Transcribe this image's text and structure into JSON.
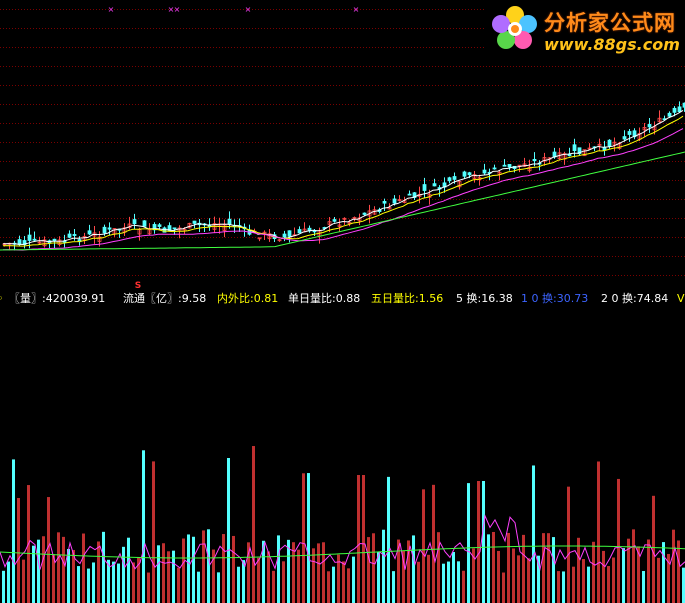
{
  "logo": {
    "name": "分析家公式网",
    "url": "www.88gs.com",
    "colors": {
      "name": "#ff8a1a",
      "url": "#ffc21a"
    }
  },
  "signal_label": "S",
  "info_bar": [
    {
      "key": "volume",
      "label": "〖量〗:",
      "value": "420039.91",
      "label_color": "#ffffff",
      "value_color": "#ffffff"
    },
    {
      "key": "float",
      "label": "流通〖亿〗:",
      "value": "9.58",
      "label_color": "#ffffff",
      "value_color": "#ffffff"
    },
    {
      "key": "inout_ratio",
      "label": "内外比:",
      "value": "0.81",
      "label_color": "#ffff00",
      "value_color": "#ffff00"
    },
    {
      "key": "day_vol_ratio",
      "label": "单日量比:",
      "value": "0.88",
      "label_color": "#ffffff",
      "value_color": "#ffffff"
    },
    {
      "key": "5day_vol_ratio",
      "label": "五日量比:",
      "value": "1.56",
      "label_color": "#ffff00",
      "value_color": "#ffff00"
    },
    {
      "key": "turn5",
      "label": "5 换:",
      "value": "16.38",
      "label_color": "#ffffff",
      "value_color": "#ffffff"
    },
    {
      "key": "turn10",
      "label": "1 0 换:",
      "value": "30.73",
      "label_color": "#3c64ff",
      "value_color": "#3c64ff"
    },
    {
      "key": "turn20",
      "label": "2 0 换:",
      "value": "74.84",
      "label_color": "#ffffff",
      "value_color": "#ffffff"
    },
    {
      "key": "more",
      "label": "V",
      "value": "",
      "label_color": "#ffff00",
      "value_color": "#ffff00"
    }
  ],
  "colors": {
    "background": "#000000",
    "grid": "#7a0000",
    "up_candle": "#ff4a4a",
    "down_candle": "#54ffff",
    "ma_white": "#ffffff",
    "ma_yellow": "#ffff00",
    "ma_magenta": "#ff40ff",
    "ma_green": "#40ff40",
    "cross_marker": "#ff40ff"
  }
}
